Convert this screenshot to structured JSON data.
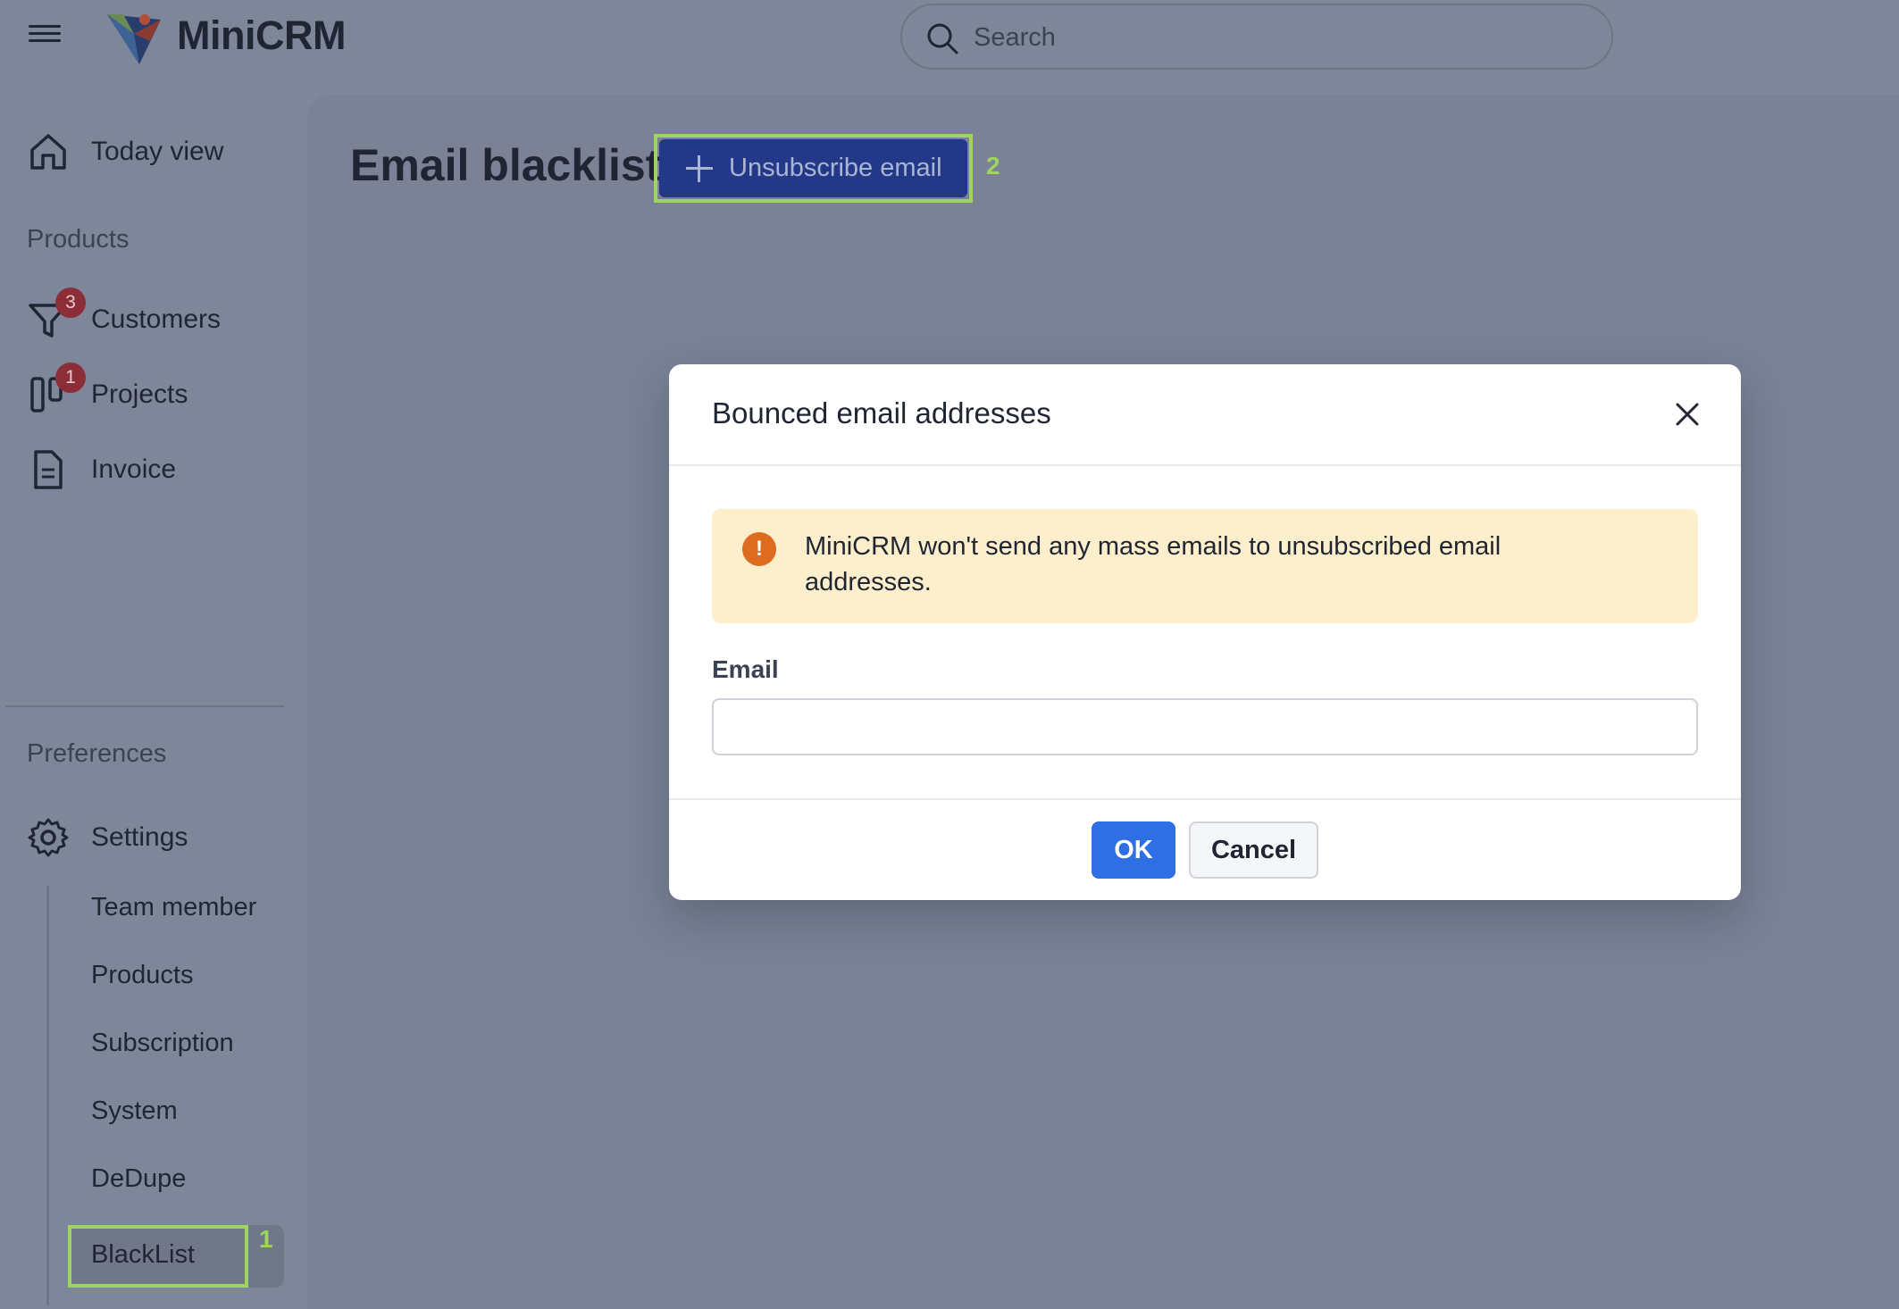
{
  "header": {
    "app_name": "MiniCRM",
    "search_placeholder": "Search"
  },
  "sidebar": {
    "items": [
      {
        "label": "Today view",
        "icon": "home-icon"
      },
      {
        "label": "Customers",
        "icon": "funnel-icon",
        "badge": "3"
      },
      {
        "label": "Projects",
        "icon": "kanban-icon",
        "badge": "1"
      },
      {
        "label": "Invoice",
        "icon": "document-icon"
      }
    ],
    "products_section_label": "Products",
    "preferences_section_label": "Preferences",
    "settings": {
      "label": "Settings",
      "icon": "gear-icon"
    },
    "settings_subitems": [
      "Team member",
      "Products",
      "Subscription",
      "System",
      "DeDupe",
      "BlackList"
    ]
  },
  "main": {
    "page_title": "Email blacklist",
    "unsubscribe_button_label": "Unsubscribe email"
  },
  "markers": [
    "1",
    "2"
  ],
  "modal": {
    "title": "Bounced email addresses",
    "alert_text": "MiniCRM won't send any mass emails to unsubscribed email addresses.",
    "email_label": "Email",
    "email_value": "",
    "ok_label": "OK",
    "cancel_label": "Cancel"
  },
  "colors": {
    "overlay_background": "#7e8699",
    "primary_button": "#2f6fe4",
    "alert_background": "#fdefcb",
    "alert_icon": "#dd6b20",
    "highlight_outline": "#9fd45f",
    "badge": "#8b2e38"
  }
}
